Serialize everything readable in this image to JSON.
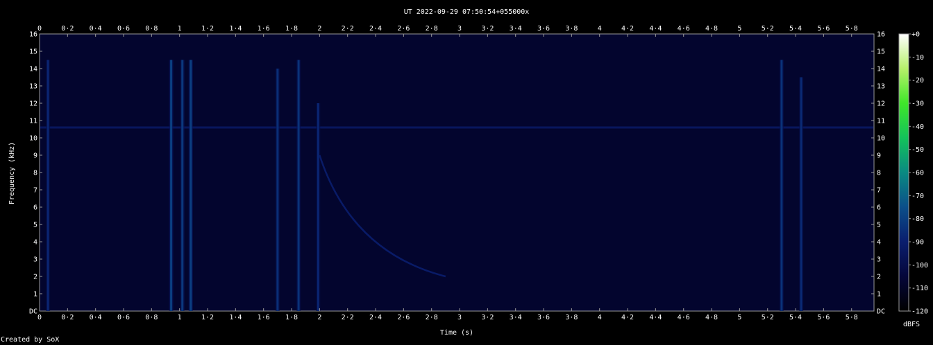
{
  "chart_data": {
    "type": "heatmap",
    "title": "UT 2022-09-29 07:50:54+055000x",
    "xlabel": "Time (s)",
    "ylabel": "Frequency (kHz)",
    "xlim": [
      0,
      5.96
    ],
    "ylim": [
      0,
      16
    ],
    "x_ticks": [
      "0",
      "0·2",
      "0·4",
      "0·6",
      "0·8",
      "1",
      "1·2",
      "1·4",
      "1·6",
      "1·8",
      "2",
      "2·2",
      "2·4",
      "2·6",
      "2·8",
      "3",
      "3·2",
      "3·4",
      "3·6",
      "3·8",
      "4",
      "4·2",
      "4·4",
      "4·6",
      "4·8",
      "5",
      "5·2",
      "5·4",
      "5·6",
      "5·8"
    ],
    "y_ticks": [
      "DC",
      "1",
      "2",
      "3",
      "4",
      "5",
      "6",
      "7",
      "8",
      "9",
      "10",
      "11",
      "12",
      "13",
      "14",
      "15",
      "16"
    ],
    "colorbar": {
      "label": "dBFS",
      "range": [
        -120,
        0
      ],
      "ticks": [
        "+0",
        "-10",
        "-20",
        "-30",
        "-40",
        "-50",
        "-60",
        "-70",
        "-80",
        "-90",
        "-100",
        "-110",
        "-120"
      ],
      "colors": [
        "#000000",
        "#04063a",
        "#0a1e6e",
        "#0b4f8a",
        "#0a8a82",
        "#13c35a",
        "#3fe62a",
        "#b7f06a",
        "#ffffff"
      ]
    },
    "background_level_dbfs": -108,
    "features": [
      {
        "kind": "tone",
        "freq_khz": 10.6,
        "level_dbfs": -95
      },
      {
        "kind": "vertical_burst",
        "time_s": 0.06,
        "fmax_khz": 14.5,
        "level_dbfs": -88
      },
      {
        "kind": "vertical_burst",
        "time_s": 0.94,
        "fmax_khz": 14.5,
        "level_dbfs": -80
      },
      {
        "kind": "vertical_burst",
        "time_s": 1.02,
        "fmax_khz": 14.5,
        "level_dbfs": -82
      },
      {
        "kind": "vertical_burst",
        "time_s": 1.08,
        "fmax_khz": 14.5,
        "level_dbfs": -80
      },
      {
        "kind": "vertical_burst",
        "time_s": 1.7,
        "fmax_khz": 14.0,
        "level_dbfs": -85
      },
      {
        "kind": "vertical_burst",
        "time_s": 1.85,
        "fmax_khz": 14.5,
        "level_dbfs": -84
      },
      {
        "kind": "vertical_burst",
        "time_s": 1.99,
        "fmax_khz": 12.0,
        "level_dbfs": -88
      },
      {
        "kind": "vertical_burst",
        "time_s": 5.3,
        "fmax_khz": 14.5,
        "level_dbfs": -84
      },
      {
        "kind": "vertical_burst",
        "time_s": 5.44,
        "fmax_khz": 13.5,
        "level_dbfs": -86
      },
      {
        "kind": "whistler",
        "t_start_s": 2.0,
        "f_start_khz": 9.0,
        "t_end_s": 2.9,
        "f_end_khz": 2.0,
        "level_dbfs": -92
      }
    ]
  },
  "credit": "Created by SoX"
}
